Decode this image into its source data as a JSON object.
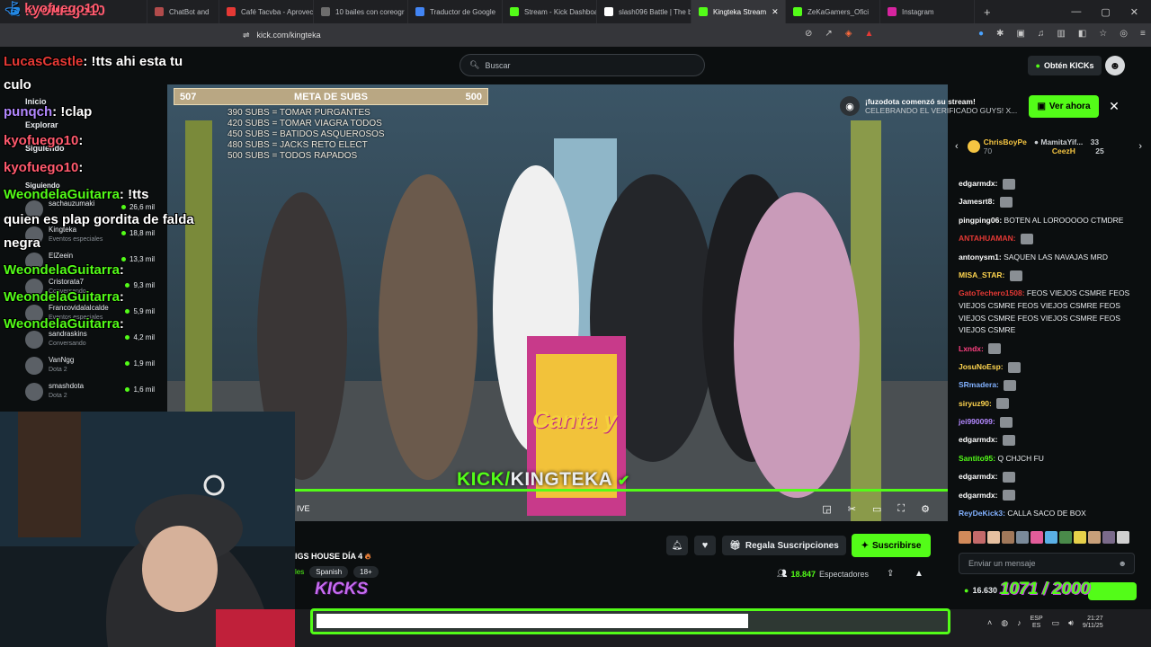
{
  "browser": {
    "tabs": [
      {
        "label": "kyofuego10",
        "color": "#1e88e5",
        "active": false
      },
      {
        "label": "ChatBot and",
        "color": "#b14b4b",
        "active": false
      },
      {
        "label": "Café Tacvba - Aprovec",
        "color": "#e53935",
        "active": false
      },
      {
        "label": "10 bailes con coreogr",
        "color": "#6d6d6d",
        "active": false
      },
      {
        "label": "Traductor de Google",
        "color": "#4285f4",
        "active": false
      },
      {
        "label": "Stream - Kick Dashboa",
        "color": "#53fc18",
        "active": false
      },
      {
        "label": "slash096 Battle | The b",
        "color": "#ffffff",
        "active": false
      },
      {
        "label": "Kingteka Stream",
        "color": "#53fc18",
        "active": true
      },
      {
        "label": "ZeKaGamers_Ofici",
        "color": "#53fc18",
        "active": false
      },
      {
        "label": "Instagram",
        "color": "#d6249f",
        "active": false
      }
    ],
    "url": "kick.com/kingteka",
    "new_tab": "+",
    "win_controls": [
      "—",
      "▢",
      "✕"
    ],
    "tab_close": "✕"
  },
  "header": {
    "search_placeholder": "Buscar",
    "kicks_button": "Obtén KICKs"
  },
  "sidebar": {
    "inicio": "Inicio",
    "explorar": "Explorar",
    "siguiendo_header": "Siguiendo",
    "siguiendo_label": "Siguiendo",
    "channels": [
      {
        "name": "sachauzumaki",
        "category": "",
        "viewers": "26,6 mil"
      },
      {
        "name": "Kingteka",
        "category": "Eventos especiales",
        "viewers": "18,8 mil"
      },
      {
        "name": "ElZeein",
        "category": "",
        "viewers": "13,3 mil"
      },
      {
        "name": "Cristorata7",
        "category": "Conversando",
        "viewers": "9,3 mil"
      },
      {
        "name": "Francovidalalcalde",
        "category": "Eventos especiales",
        "viewers": "5,9 mil"
      },
      {
        "name": "sandraskins",
        "category": "Conversando",
        "viewers": "4,2 mil"
      },
      {
        "name": "VanNgg",
        "category": "Dota 2",
        "viewers": "1,9 mil"
      },
      {
        "name": "smashdota",
        "category": "Dota 2",
        "viewers": "1,6 mil"
      }
    ]
  },
  "overlay_chat": [
    {
      "user": "LucasCastle",
      "text": ": !tts ahi esta tu",
      "color": "#e53935"
    },
    {
      "user": "",
      "text": "culo",
      "color": "#ffffff"
    },
    {
      "user": "punqch",
      "text": ": !clap",
      "color": "#b388ff"
    },
    {
      "user": "kyofuego10",
      "text": ":",
      "color": "#ff5a6e"
    },
    {
      "user": "kyofuego10",
      "text": ":",
      "color": "#ff5a6e"
    },
    {
      "user": "WeondelaGuitarra",
      "text": ": !tts",
      "color": "#53fc18"
    },
    {
      "user": "",
      "text": "quien es plap gordita de falda",
      "color": "#ffffff"
    },
    {
      "user": "",
      "text": "negra",
      "color": "#ffffff"
    },
    {
      "user": "WeondelaGuitarra",
      "text": ":",
      "color": "#53fc18"
    },
    {
      "user": "WeondelaGuitarra",
      "text": ":",
      "color": "#53fc18"
    },
    {
      "user": "WeondelaGuitarra",
      "text": ":",
      "color": "#53fc18"
    }
  ],
  "overlay_top": {
    "name": "kyofuego10"
  },
  "video": {
    "goal_left": "507",
    "goal_title": "META DE SUBS",
    "goal_right": "500",
    "goal_items": [
      "390 SUBS = TOMAR PURGANTES",
      "420 SUBS = TOMAR VIAGRA TODOS",
      "450 SUBS = BATIDOS ASQUEROSOS",
      "480 SUBS = JACKS RETO ELECT",
      "500 SUBS = TODOS RAPADOS"
    ],
    "watermark_a": "KICK/",
    "watermark_b": "KINGTEKA",
    "live_label": "IVE",
    "box_text": "Canta y"
  },
  "notification": {
    "title": "¡fuzodota comenzó su stream!",
    "subtitle": "CELEBRANDO EL VERIFICADO GUYS! X...",
    "button": "Ver ahora"
  },
  "chat": {
    "gifters": [
      {
        "name": "ChrisBoyPe",
        "count": "70"
      },
      {
        "name": "MamitaYif...",
        "count": "33"
      },
      {
        "name": "CeezH",
        "count": "25"
      }
    ],
    "messages": [
      {
        "user": "edgarmdx:",
        "text": "",
        "color": "#ffffff"
      },
      {
        "user": "Jamesrt8:",
        "text": "",
        "color": "#ffffff"
      },
      {
        "user": "pingping06:",
        "text": "BOTEN AL LOROOOOO CTMDRE",
        "color": "#ffffff"
      },
      {
        "user": "ANTAHUAMAN:",
        "text": "",
        "color": "#e53935"
      },
      {
        "user": "antonysm1:",
        "text": "SAQUEN LAS NAVAJAS MRD",
        "color": "#ffffff"
      },
      {
        "user": "MISA_STAR:",
        "text": "",
        "color": "#ffd54f"
      },
      {
        "user": "GatoTechero1508:",
        "text": "FEOS VIEJOS CSMRE FEOS VIEJOS CSMRE FEOS VIEJOS CSMRE FEOS VIEJOS CSMRE FEOS VIEJOS CSMRE FEOS VIEJOS CSMRE",
        "color": "#e53935"
      },
      {
        "user": "Lxndx:",
        "text": "",
        "color": "#ff4081"
      },
      {
        "user": "JosuNoEsp:",
        "text": "",
        "color": "#ffd54f"
      },
      {
        "user": "SRmadera:",
        "text": "",
        "color": "#82b1ff"
      },
      {
        "user": "siryuz90:",
        "text": "",
        "color": "#ffd54f"
      },
      {
        "user": "jei990099:",
        "text": "",
        "color": "#b388ff"
      },
      {
        "user": "edgarmdx:",
        "text": "",
        "color": "#ffffff"
      },
      {
        "user": "Santito95:",
        "text": "Q CHJCH FU",
        "color": "#53fc18"
      },
      {
        "user": "edgarmdx:",
        "text": "",
        "color": "#ffffff"
      },
      {
        "user": "edgarmdx:",
        "text": "",
        "color": "#ffffff"
      },
      {
        "user": "ReyDeKick3:",
        "text": "CALLA SACO DE BOX",
        "color": "#82b1ff"
      }
    ],
    "input_placeholder": "Enviar un mensaje",
    "kicks_balance": "16.630"
  },
  "below_player": {
    "gift_button": "Regala Suscripciones",
    "subscribe_button": "Suscribirse",
    "title": "IGS HOUSE DÍA 4",
    "category": "les",
    "tag1": "Spanish",
    "tag2": "18+",
    "viewers": "18.847",
    "viewers_label": "Espectadores"
  },
  "stream_overlay": {
    "kicks_word": "KICKS",
    "subs_counter": "1071 / 2000"
  },
  "taskbar": {
    "lang": "ESP",
    "lang2": "ES",
    "time": "21:27",
    "date": "9/11/25"
  },
  "colors": {
    "accent": "#53fc18",
    "bg": "#0b0e0f"
  }
}
